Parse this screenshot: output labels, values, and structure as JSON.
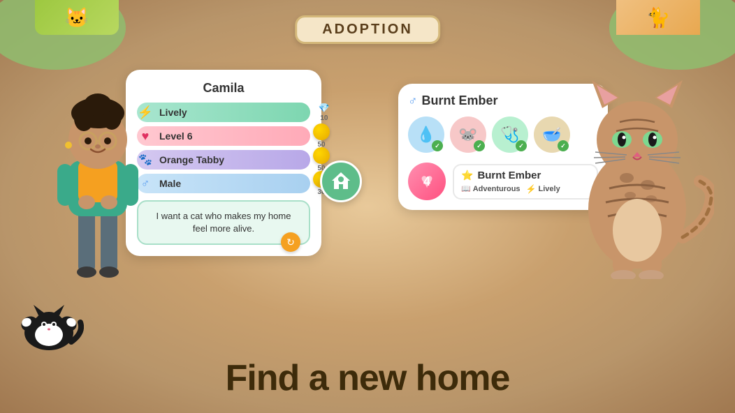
{
  "background": {
    "color": "#d4a96a"
  },
  "adoption_banner": {
    "label": "ADOPTION"
  },
  "left_card": {
    "title": "Camila",
    "stats": [
      {
        "icon": "⚡",
        "label": "Lively",
        "cost": "10",
        "bar_class": "lively-bar",
        "icon_type": "bolt"
      },
      {
        "icon": "♥",
        "label": "Level 6",
        "cost": "50",
        "bar_class": "level-bar",
        "icon_type": "heart"
      },
      {
        "icon": "🐾",
        "label": "Orange Tabby",
        "cost": "50",
        "bar_class": "tabby-bar",
        "icon_type": "paw"
      },
      {
        "icon": "♂",
        "label": "Male",
        "cost": "30",
        "bar_class": "male-bar",
        "icon_type": "gender"
      }
    ],
    "speech_bubble": "I want a cat who makes my home feel more alive."
  },
  "right_card": {
    "pet_name": "Burnt Ember",
    "gender": "♂",
    "level": "4",
    "traits": [
      {
        "label": "Adventurous",
        "icon": "📖"
      },
      {
        "label": "Lively",
        "icon": "⚡"
      }
    ],
    "items": [
      {
        "color": "ic-blue",
        "icon": "💧",
        "checked": true
      },
      {
        "color": "ic-pink",
        "icon": "🐭",
        "checked": true
      },
      {
        "color": "ic-green",
        "icon": "🩺",
        "checked": true
      },
      {
        "color": "ic-tan",
        "icon": "🥣",
        "checked": true
      }
    ]
  },
  "tagline": "Find a new home",
  "center_icon": "🏠",
  "refresh_icon": "↻"
}
